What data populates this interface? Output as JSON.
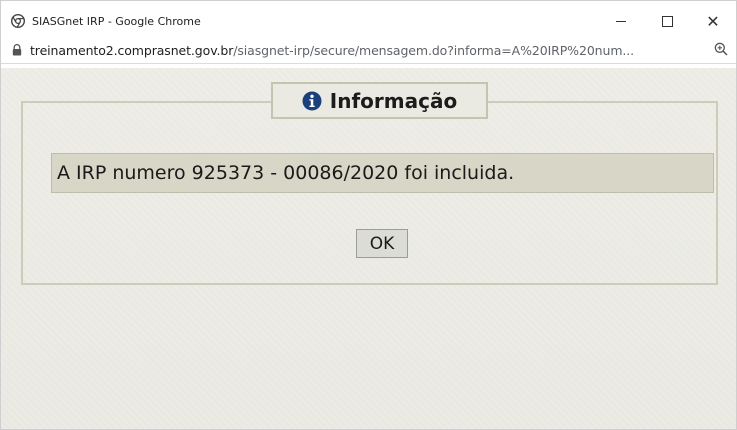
{
  "window": {
    "title": "SIASGnet IRP - Google Chrome"
  },
  "address_bar": {
    "host": "treinamento2.comprasnet.gov.br",
    "path": "/siasgnet-irp/secure/mensagem.do?informa=A%20IRP%20num..."
  },
  "dialog": {
    "legend": "Informação",
    "message": "A IRP numero 925373 - 00086/2020 foi incluida.",
    "ok_label": "OK"
  },
  "colors": {
    "info_icon": "#1a3f7a",
    "page_background": "#eceae3"
  },
  "icons": [
    "chrome-app-icon",
    "minimize-icon",
    "maximize-icon",
    "close-icon",
    "lock-icon",
    "zoom-icon",
    "info-icon"
  ]
}
